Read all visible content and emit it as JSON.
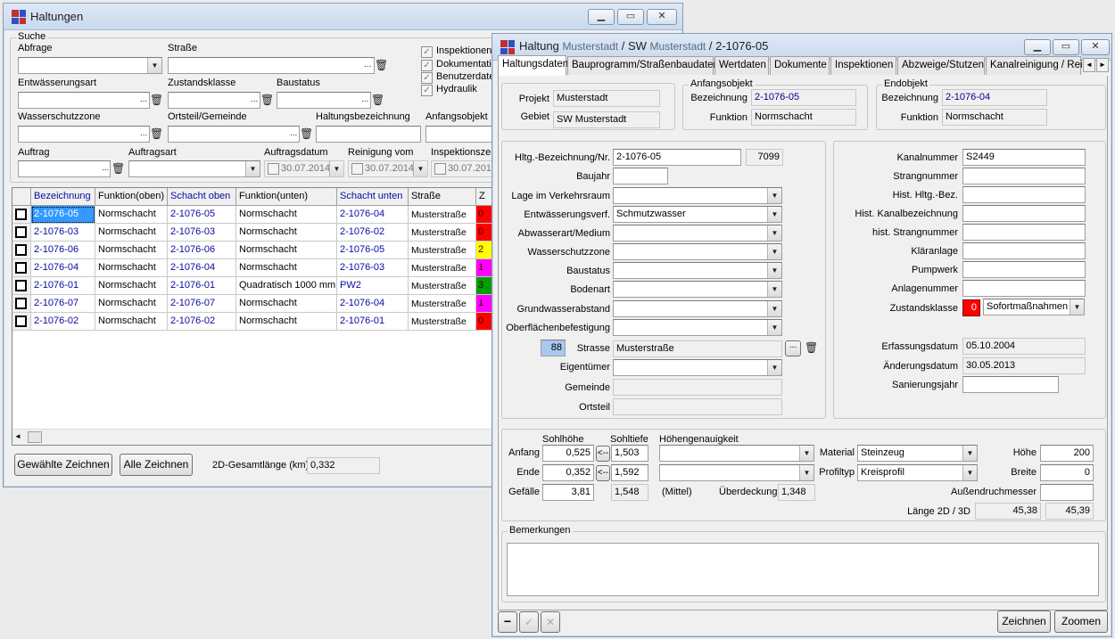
{
  "colors": {
    "red": "#ff0000",
    "yellow": "#ffff00",
    "magenta": "#ff00ff",
    "green": "#00a000",
    "selection": "#3399ff",
    "link": "#0a0aa0"
  },
  "left_window": {
    "title": "Haltungen",
    "search_group": "Suche",
    "labels": {
      "abfrage": "Abfrage",
      "strasse": "Straße",
      "entwaesserungsart": "Entwässerungsart",
      "zustandsklasse": "Zustandsklasse",
      "baustatus": "Baustatus",
      "wasserschutzzone": "Wasserschutzzone",
      "ortsteil": "Ortsteil/Gemeinde",
      "haltungsbezeichnung": "Haltungsbezeichnung",
      "anfangsobjekt": "Anfangsobjekt",
      "auftrag": "Auftrag",
      "auftragsart": "Auftragsart",
      "auftragsdatum": "Auftragsdatum",
      "reinigung": "Reinigung vom",
      "inspektionszeit": "Inspektionszeit"
    },
    "checks": [
      {
        "label": "Inspektionen",
        "checked": "✓"
      },
      {
        "label": "Dokumentatio",
        "checked": "✓"
      },
      {
        "label": "Benutzerdate",
        "checked": "✓"
      },
      {
        "label": "Hydraulik",
        "checked": "✓"
      }
    ],
    "dates": {
      "auftragsdatum": "30.07.2014",
      "reinigung": "30.07.2014",
      "inspektion": "30.07.2014"
    },
    "columns": [
      "Bezeichnung",
      "Funktion(oben)",
      "Schacht oben",
      "Funktion(unten)",
      "Schacht unten",
      "Straße",
      "Z"
    ],
    "rows": [
      {
        "bez": "2-1076-05",
        "fo": "Normschacht",
        "so": "2-1076-05",
        "fu": "Normschacht",
        "su": "2-1076-04",
        "str": "Musterstraße",
        "z": "0",
        "zc": "#ff0000"
      },
      {
        "bez": "2-1076-03",
        "fo": "Normschacht",
        "so": "2-1076-03",
        "fu": "Normschacht",
        "su": "2-1076-02",
        "str": "Musterstraße",
        "z": "0",
        "zc": "#ff0000"
      },
      {
        "bez": "2-1076-06",
        "fo": "Normschacht",
        "so": "2-1076-06",
        "fu": "Normschacht",
        "su": "2-1076-05",
        "str": "Musterstraße",
        "z": "2",
        "zc": "#ffff00"
      },
      {
        "bez": "2-1076-04",
        "fo": "Normschacht",
        "so": "2-1076-04",
        "fu": "Normschacht",
        "su": "2-1076-03",
        "str": "Musterstraße",
        "z": "1",
        "zc": "#ff00ff"
      },
      {
        "bez": "2-1076-01",
        "fo": "Normschacht",
        "so": "2-1076-01",
        "fu": "Quadratisch 1000 mm",
        "su": "PW2",
        "str": "Musterstraße",
        "z": "3",
        "zc": "#00a000"
      },
      {
        "bez": "2-1076-07",
        "fo": "Normschacht",
        "so": "2-1076-07",
        "fu": "Normschacht",
        "su": "2-1076-04",
        "str": "Musterstraße",
        "z": "1",
        "zc": "#ff00ff"
      },
      {
        "bez": "2-1076-02",
        "fo": "Normschacht",
        "so": "2-1076-02",
        "fu": "Normschacht",
        "su": "2-1076-01",
        "str": "Musterstraße",
        "z": "0",
        "zc": "#ff0000"
      }
    ],
    "buttons": {
      "gewaehlte": "Gewählte Zeichnen",
      "alle": "Alle Zeichnen"
    },
    "gesamtlaenge_label": "2D-Gesamtlänge (km)",
    "gesamtlaenge_value": "0,332"
  },
  "right_window": {
    "title_main": "Haltung",
    "title_gebiet": "Musterstadt",
    "title_sep": " / SW ",
    "title_sw": "Musterstadt",
    "title_id": " / 2-1076-05",
    "tabs": [
      "Haltungsdaten",
      "Bauprogramm/Straßenbaudaten",
      "Wertdaten",
      "Dokumente",
      "Inspektionen",
      "Abzweige/Stutzen",
      "Kanalreinigung / Rein"
    ],
    "projekt_label": "Projekt",
    "projekt": "Musterstadt",
    "gebiet_label": "Gebiet",
    "gebiet": "SW Musterstadt",
    "anfang_group": "Anfangsobjekt",
    "ende_group": "Endobjekt",
    "bezeichnung_label": "Bezeichnung",
    "funktion_label": "Funktion",
    "anfang_bez": "2-1076-05",
    "anfang_fun": "Normschacht",
    "ende_bez": "2-1076-04",
    "ende_fun": "Normschacht",
    "mid_labels": [
      "Hltg.-Bezeichnung/Nr.",
      "Baujahr",
      "Lage im Verkehrsraum",
      "Entwässerungsverf.",
      "Abwasserart/Medium",
      "Wasserschutzzone",
      "Baustatus",
      "Bodenart",
      "Grundwasserabstand",
      "Oberflächenbefestigung"
    ],
    "hltg_bez": "2-1076-05",
    "hltg_nr": "7099",
    "entwaesserungsverf": "Schmutzwasser",
    "strasse_num": "88",
    "strasse_label": "Strasse",
    "strasse": "Musterstraße",
    "eigentuemer_label": "Eigentümer",
    "gemeinde_label": "Gemeinde",
    "ortsteil_label": "Ortsteil",
    "right_labels": [
      "Kanalnummer",
      "Strangnummer",
      "Hist. Hltg.-Bez.",
      "Hist. Kanalbezeichnung",
      "hist. Strangnummer",
      "Kläranlage",
      "Pumpwerk",
      "Anlagenummer"
    ],
    "kanalnummer": "S2449",
    "zustandsklasse_label": "Zustandsklasse",
    "zustandsklasse_num": "0",
    "zustandsklasse": "Sofortmaßnahmen",
    "erfassung_label": "Erfassungsdatum",
    "erfassung": "05.10.2004",
    "aenderung_label": "Änderungsdatum",
    "aenderung": "30.05.2013",
    "sanierung_label": "Sanierungsjahr",
    "sohlhoehe_label": "Sohlhöhe",
    "sohltiefe_label": "Sohltiefe",
    "hoehengenauigkeit_label": "Höhengenauigkeit",
    "anfang_label": "Anfang",
    "ende_label": "Ende",
    "gefaelle_label": "Gefälle",
    "anfang_hoehe": "0,525",
    "anfang_tiefe": "1,503",
    "ende_hoehe": "0,352",
    "ende_tiefe": "1,592",
    "gefaelle": "3,81",
    "mittel_tiefe": "1,548",
    "arrow": "<--",
    "mittel_label": "(Mittel)",
    "ueberdeckung_label": "Überdeckung",
    "ueberdeckung": "1,348",
    "material_label": "Material",
    "material": "Steinzeug",
    "profiltyp_label": "Profiltyp",
    "profiltyp": "Kreisprofil",
    "hoehe_label": "Höhe",
    "hoehe": "200",
    "breite_label": "Breite",
    "breite": "0",
    "aussendruchmesser_label": "Außendruchmesser",
    "laenge_label": "Länge 2D / 3D",
    "laenge2d": "45,38",
    "laenge3d": "45,39",
    "bemerkungen_label": "Bemerkungen",
    "zeichnen": "Zeichnen",
    "zoomen": "Zoomen"
  }
}
